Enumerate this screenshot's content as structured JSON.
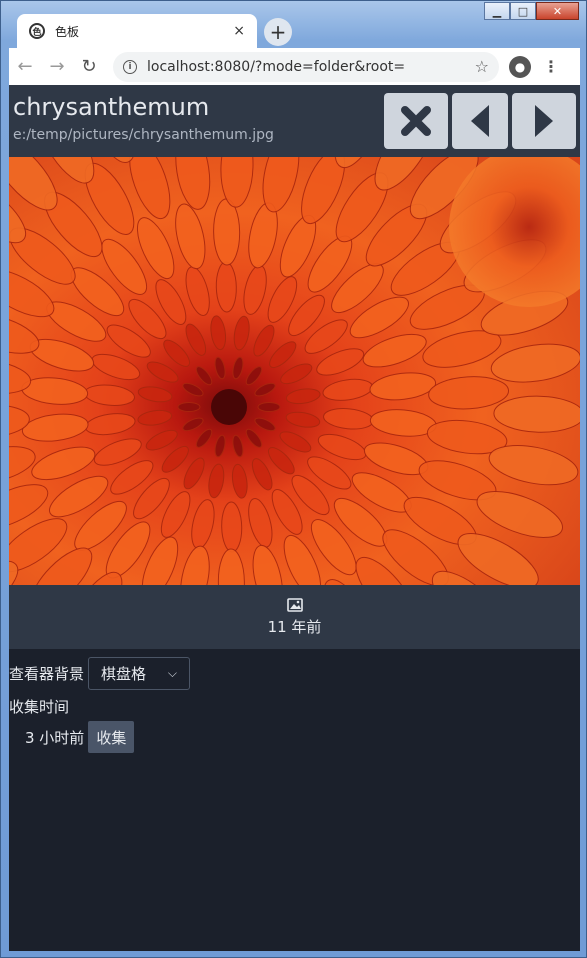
{
  "browser": {
    "tab_title": "色板",
    "tab_close": "×",
    "new_tab": "+",
    "url": "localhost:8080/?mode=folder&root="
  },
  "viewer": {
    "title": "chrysanthemum",
    "path": "e:/temp/pictures/chrysanthemum.jpg",
    "photo_taken": "11 年前"
  },
  "settings": {
    "background_label": "查看器背景",
    "background_value": "棋盘格",
    "collect_time_label": "收集时间",
    "collect_time_value": "3 小时前",
    "collect_button": "收集"
  },
  "colors": {
    "header_bg": "#2f3846",
    "page_bg": "#1b202b",
    "button_bg": "#cfd5dd",
    "accent_orange": "#f05a1c"
  },
  "icons": [
    "close-icon",
    "chevron-left-icon",
    "chevron-right-icon",
    "image-icon",
    "chevron-down-icon"
  ]
}
